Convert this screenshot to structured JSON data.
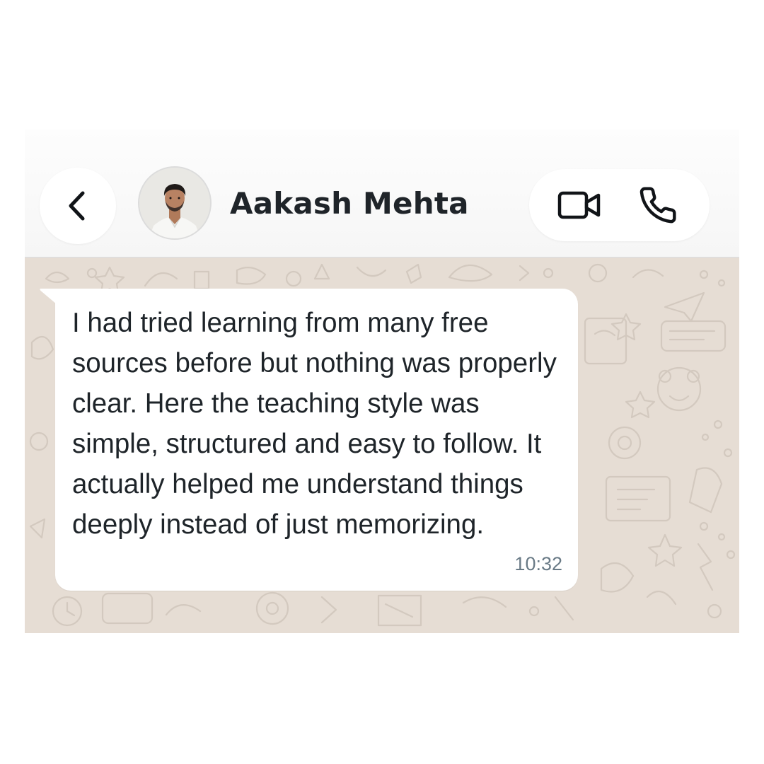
{
  "header": {
    "contact_name": "Aakash Mehta",
    "back_icon": "chevron-left-icon",
    "avatar": "contact-photo",
    "video_call_icon": "video-camera-icon",
    "voice_call_icon": "phone-icon"
  },
  "chat": {
    "messages": [
      {
        "direction": "incoming",
        "text": "I had tried learning from many free sources before but nothing was properly clear. Here the teaching style was simple, structured and easy to follow. It actually helped me understand things deeply instead of just memorizing.",
        "time": "10:32"
      }
    ]
  },
  "colors": {
    "chat_background": "#e6ddd4",
    "header_background": "#f8f8f8",
    "bubble": "#ffffff",
    "text": "#1e2429",
    "timestamp": "#697a86"
  }
}
